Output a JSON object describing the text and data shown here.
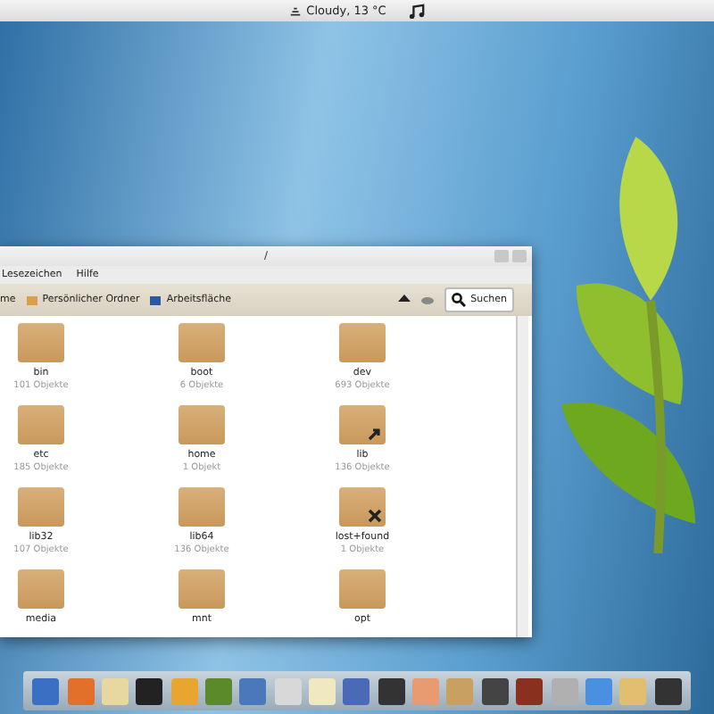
{
  "top_bar": {
    "weather": "Cloudy, 13 °C"
  },
  "window": {
    "title": "/",
    "menu": [
      "Lesezeichen",
      "Hilfe"
    ],
    "places": [
      {
        "label": "me",
        "kind": "home"
      },
      {
        "label": "Persönlicher Ordner",
        "kind": "folder"
      },
      {
        "label": "Arbeitsfläche",
        "kind": "desktop"
      }
    ],
    "search": {
      "label": "Suchen"
    },
    "folders": [
      {
        "name": "bin",
        "count": "101 Objekte"
      },
      {
        "name": "boot",
        "count": "6 Objekte"
      },
      {
        "name": "dev",
        "count": "693 Objekte"
      },
      {
        "name": "etc",
        "count": "185 Objekte"
      },
      {
        "name": "home",
        "count": "1 Objekt"
      },
      {
        "name": "lib",
        "count": "136 Objekte",
        "kind": "link"
      },
      {
        "name": "lib32",
        "count": "107 Objekte"
      },
      {
        "name": "lib64",
        "count": "136 Objekte"
      },
      {
        "name": "lost+found",
        "count": "1 Objekte",
        "kind": "unreadable"
      },
      {
        "name": "media"
      },
      {
        "name": "mnt"
      },
      {
        "name": "opt"
      }
    ]
  }
}
